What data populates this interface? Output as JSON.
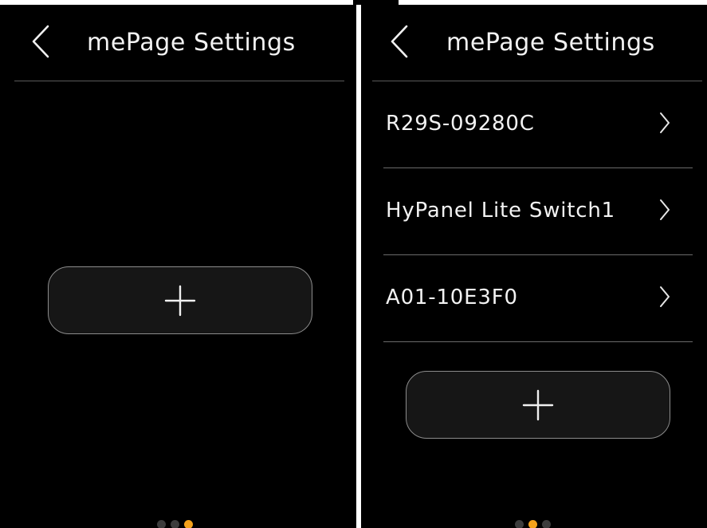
{
  "accent_color": "#f5a21b",
  "left_screen": {
    "title": "mePage Settings",
    "back_icon": "chevron-left-icon",
    "add_icon": "plus-icon",
    "pager": {
      "count": 3,
      "active_index": 2
    }
  },
  "right_screen": {
    "title": "mePage Settings",
    "back_icon": "chevron-left-icon",
    "add_icon": "plus-icon",
    "devices": [
      {
        "label": "R29S-09280C",
        "icon": "chevron-right-icon"
      },
      {
        "label": "HyPanel Lite Switch1",
        "icon": "chevron-right-icon"
      },
      {
        "label": "A01-10E3F0",
        "icon": "chevron-right-icon"
      }
    ],
    "pager": {
      "count": 3,
      "active_index": 1
    }
  }
}
